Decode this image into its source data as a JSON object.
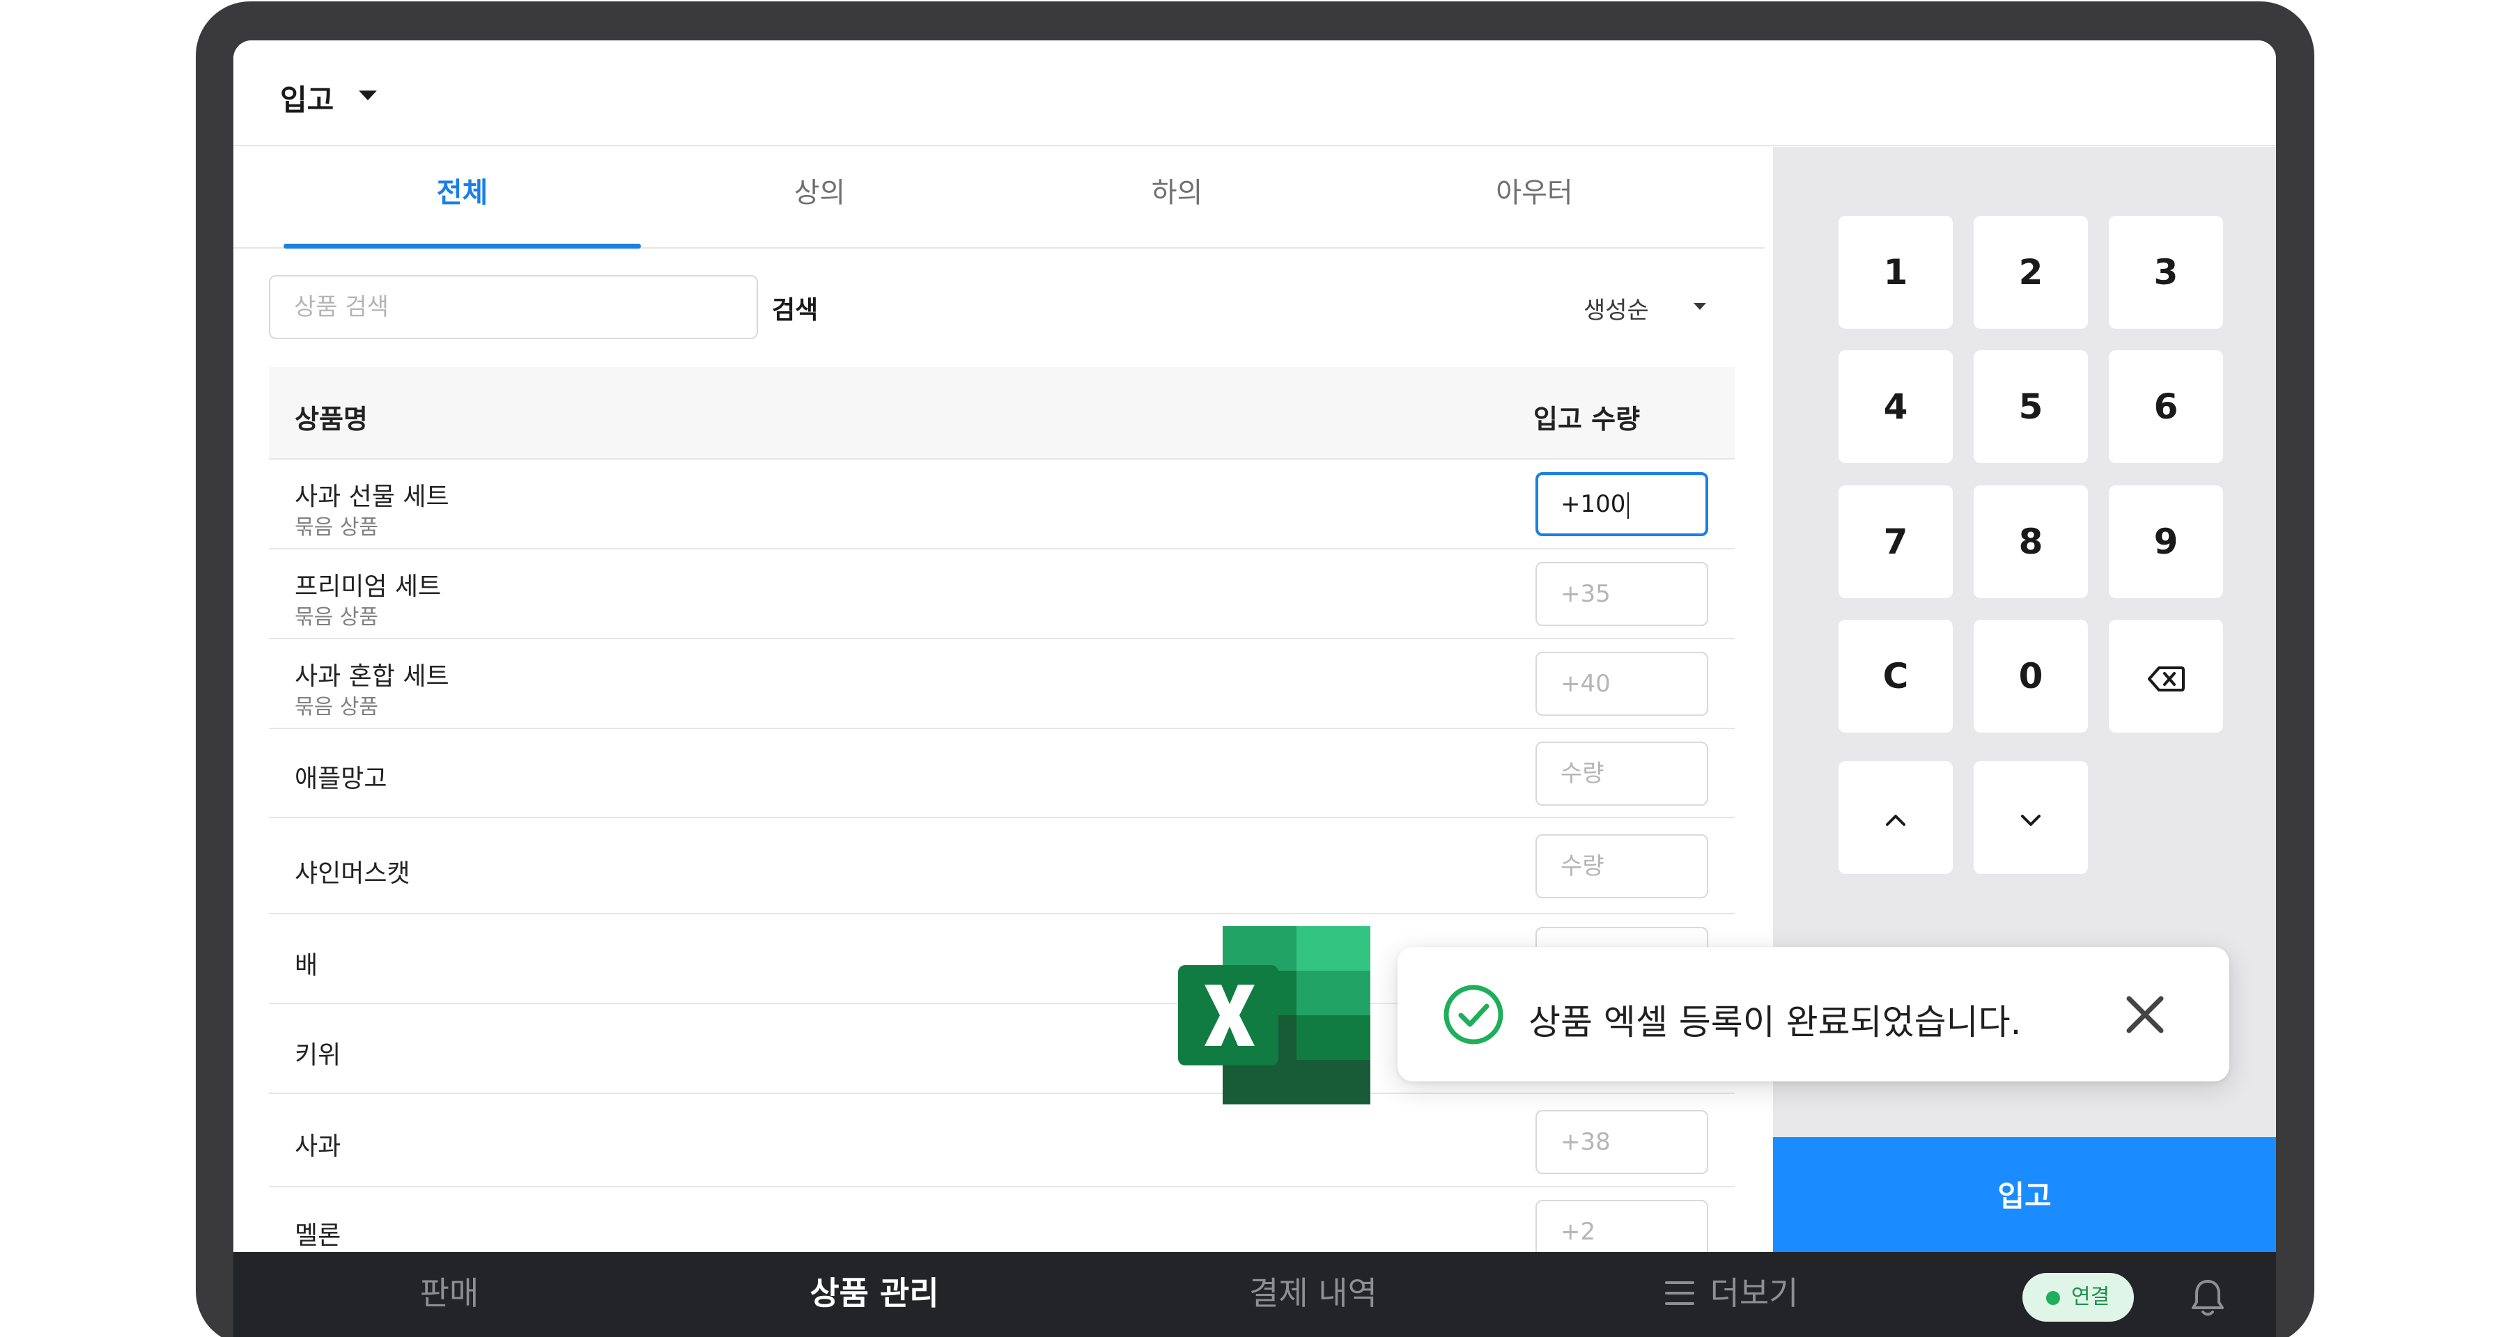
{
  "header": {
    "mode_label": "입고"
  },
  "tabs": [
    {
      "label": "전체",
      "active": true
    },
    {
      "label": "상의",
      "active": false
    },
    {
      "label": "하의",
      "active": false
    },
    {
      "label": "아우터",
      "active": false
    }
  ],
  "search": {
    "placeholder": "상품 검색",
    "button_label": "검색"
  },
  "sort": {
    "label": "생성순"
  },
  "table": {
    "col_name": "상품명",
    "col_qty": "입고 수량",
    "rows": [
      {
        "name": "사과 선물 세트",
        "sub": "묶음 상품",
        "qty": "+100",
        "focused": true
      },
      {
        "name": "프리미엄 세트",
        "sub": "묶음 상품",
        "qty": "+35"
      },
      {
        "name": "사과 혼합 세트",
        "sub": "묶음 상품",
        "qty": "+40"
      },
      {
        "name": "애플망고",
        "sub": "",
        "qty": "수량"
      },
      {
        "name": "샤인머스캣",
        "sub": "",
        "qty": "수량"
      },
      {
        "name": "배",
        "sub": "",
        "qty": ""
      },
      {
        "name": "키위",
        "sub": "",
        "qty": ""
      },
      {
        "name": "사과",
        "sub": "",
        "qty": "+38"
      },
      {
        "name": "멜론",
        "sub": "",
        "qty": "+2"
      }
    ]
  },
  "keypad": {
    "digits": [
      "1",
      "2",
      "3",
      "4",
      "5",
      "6",
      "7",
      "8",
      "9",
      "C",
      "0"
    ],
    "backspace_icon": "backspace-icon",
    "up_icon": "chevron-up-icon",
    "down_icon": "chevron-down-icon"
  },
  "submit_label": "입고",
  "bottom_nav": {
    "sell": "판매",
    "products": "상품 관리",
    "payments": "결제 내역",
    "more": "더보기",
    "connection": "연결"
  },
  "toast": {
    "message": "상품 엑셀 등록이 완료되었습니다."
  },
  "colors": {
    "accent": "#1a7fe6",
    "submit": "#1a8cff",
    "nav_bg": "#232428",
    "excel_green": "#107c41",
    "success_green": "#1fae5b"
  }
}
